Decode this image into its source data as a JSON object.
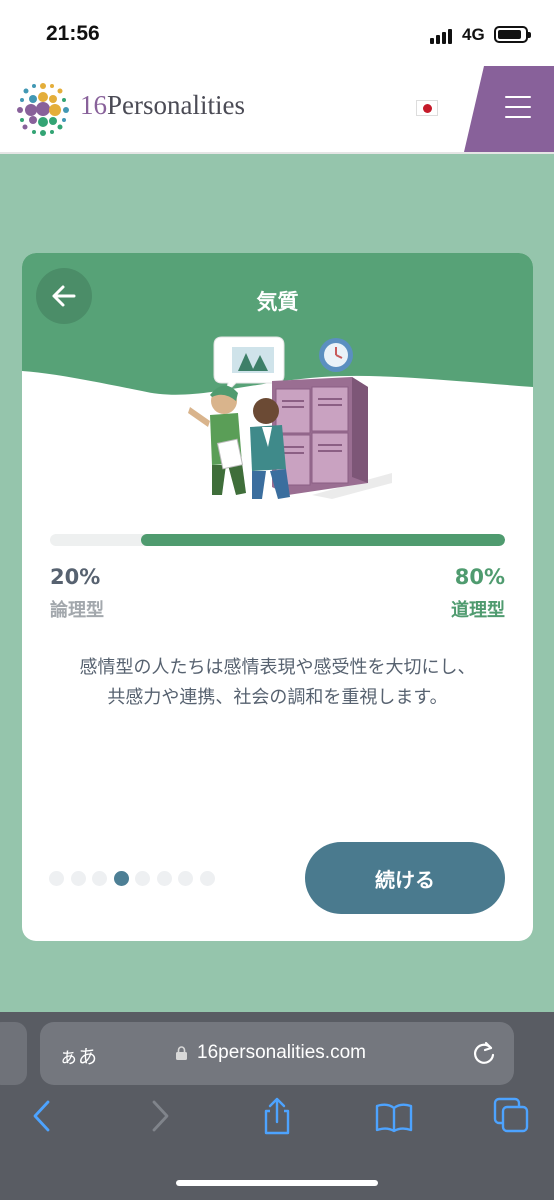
{
  "status_bar": {
    "time": "21:56",
    "network": "4G",
    "battery_level": 0.9
  },
  "header": {
    "logo_number": "16",
    "logo_name": "Personalities",
    "language_flag": "japan-flag-icon",
    "menu_color": "#88619a"
  },
  "card": {
    "title": "気質",
    "back_icon": "arrow-left-icon",
    "illustration": "office-lockers-illustration",
    "header_color": "#57a277",
    "progress": {
      "left_percent": "20%",
      "left_label": "論理型",
      "right_percent": "80%",
      "right_label": "道理型",
      "value": 0.8
    },
    "description_lines": [
      "感情型の人たちは感情表現や感受性を大切にし、",
      "共感力や連携、社会の調和を重視します。"
    ],
    "steps": {
      "total": 8,
      "current": 4
    },
    "continue_label": "続ける"
  },
  "browser": {
    "text_size_label": "ぁあ",
    "url": "16personalities.com",
    "toolbar_icons": [
      "back-icon",
      "forward-icon",
      "share-icon",
      "bookmarks-icon",
      "tabs-icon"
    ]
  },
  "colors": {
    "page_bg": "#95c5ac",
    "accent_green": "#4f9b6f",
    "button_blue": "#4a7a8e",
    "text_gray": "#576270",
    "safari_blue": "#4da3ff"
  }
}
